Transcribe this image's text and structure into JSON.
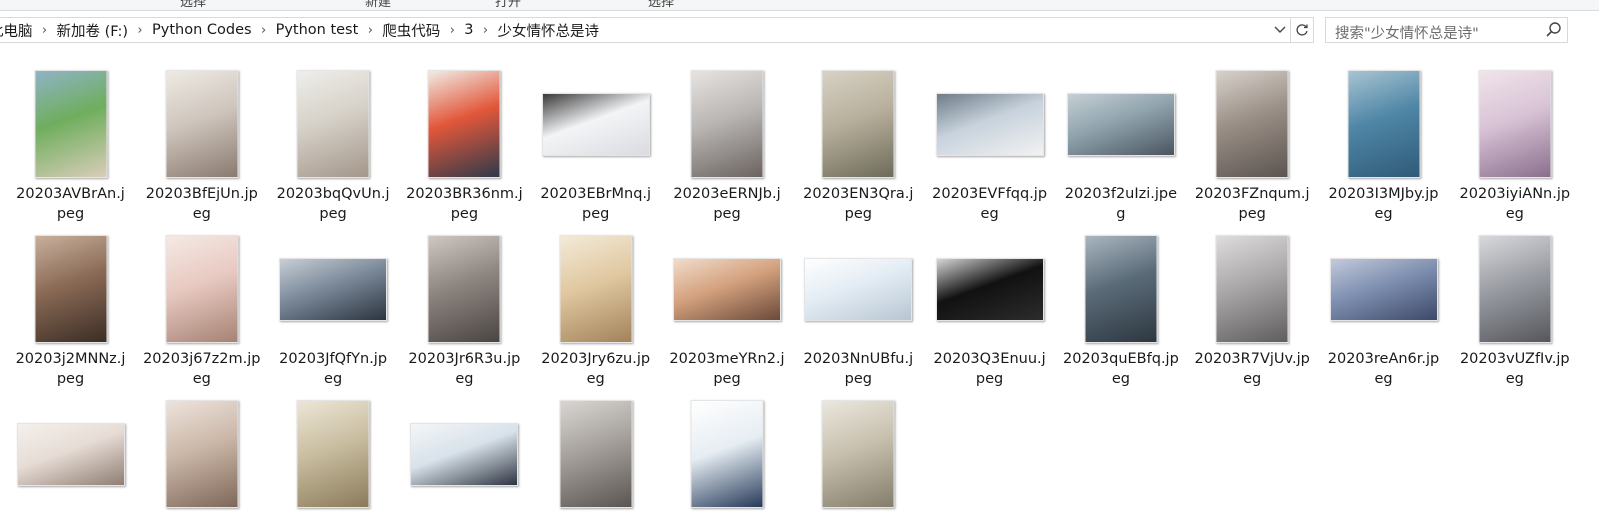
{
  "ribbon": {
    "labels": [
      "选择",
      "新建",
      "打开",
      "选择"
    ]
  },
  "address": {
    "crumbs": [
      "此电脑",
      "新加卷 (F:)",
      "Python Codes",
      "Python test",
      "爬虫代码",
      "3",
      "少女情怀总是诗"
    ]
  },
  "search": {
    "placeholder": "搜索\"少女情怀总是诗\""
  },
  "files": [
    {
      "name_lines": "20203AVBrAn.j\npeg",
      "orient": "p",
      "colors": [
        "#6fae5d",
        "#d9cdb9",
        "#8fb3c7"
      ]
    },
    {
      "name_lines": "20203BfEjUn.jp\neg",
      "orient": "p",
      "colors": [
        "#cfc6bd",
        "#8a7a70",
        "#eeeae4"
      ]
    },
    {
      "name_lines": "20203bqQvUn.j\npeg",
      "orient": "p",
      "colors": [
        "#d6d1c8",
        "#a3968a",
        "#efeeea"
      ]
    },
    {
      "name_lines": "20203BR36nm.j\npeg",
      "orient": "p",
      "colors": [
        "#e2573a",
        "#2e3a4a",
        "#f1ece6"
      ]
    },
    {
      "name_lines": "20203EBrMnq.j\npeg",
      "orient": "l",
      "colors": [
        "#f3f4f6",
        "#d9dbe0",
        "#3a3a3a"
      ]
    },
    {
      "name_lines": "20203eERNJb.j\npeg",
      "orient": "p",
      "colors": [
        "#b9b6b4",
        "#6b6360",
        "#e6e3e1"
      ]
    },
    {
      "name_lines": "20203EN3Qra.j\npeg",
      "orient": "p",
      "colors": [
        "#b8b09d",
        "#6e6b5a",
        "#d7d2c4"
      ]
    },
    {
      "name_lines": "20203EVFfqq.jp\neg",
      "orient": "l",
      "colors": [
        "#c7d2dc",
        "#f2f2f2",
        "#6f7c88"
      ]
    },
    {
      "name_lines": "20203f2uIzi.jpe\ng",
      "orient": "l",
      "colors": [
        "#8fa3ad",
        "#4a5560",
        "#c6cfd4"
      ]
    },
    {
      "name_lines": "20203FZnqum.j\npeg",
      "orient": "p",
      "colors": [
        "#9a8f86",
        "#5b5450",
        "#d7d1cb"
      ]
    },
    {
      "name_lines": "20203I3MJby.jp\neg",
      "orient": "p",
      "colors": [
        "#4f86a6",
        "#2f5a78",
        "#a7c4d2"
      ]
    },
    {
      "name_lines": "20203iyiANn.jp\neg",
      "orient": "p",
      "colors": [
        "#d8c3d6",
        "#8a6f8d",
        "#f1e4ea"
      ]
    },
    {
      "name_lines": "20203j2MNNz.j\npeg",
      "orient": "p",
      "colors": [
        "#8a6a55",
        "#3b2d25",
        "#c8b09d"
      ]
    },
    {
      "name_lines": "20203j67z2m.jp\neg",
      "orient": "p",
      "colors": [
        "#e8c9c1",
        "#a58274",
        "#f5e9e4"
      ]
    },
    {
      "name_lines": "20203JfQfYn.jp\neg",
      "orient": "l",
      "colors": [
        "#7b8a9a",
        "#2c3440",
        "#c8ced5"
      ]
    },
    {
      "name_lines": "20203Jr6R3u.jp\neg",
      "orient": "p",
      "colors": [
        "#8d8580",
        "#4b4542",
        "#cfc8c2"
      ]
    },
    {
      "name_lines": "20203Jry6zu.jp\neg",
      "orient": "p",
      "colors": [
        "#e0c8a0",
        "#a3825b",
        "#f3ead9"
      ]
    },
    {
      "name_lines": "20203meYRn2.j\npeg",
      "orient": "l",
      "colors": [
        "#d4a17e",
        "#6a4a39",
        "#f1dccb"
      ]
    },
    {
      "name_lines": "20203NnUBfu.j\npeg",
      "orient": "l",
      "colors": [
        "#e3ecf4",
        "#b8c6d2",
        "#ffffff"
      ]
    },
    {
      "name_lines": "20203Q3Enuu.j\npeg",
      "orient": "l",
      "colors": [
        "#111111",
        "#2c2c2c",
        "#d6d6d6"
      ]
    },
    {
      "name_lines": "20203quEBfq.jp\neg",
      "orient": "p",
      "colors": [
        "#5a6b78",
        "#2d3740",
        "#a9b6c0"
      ]
    },
    {
      "name_lines": "20203R7VjUv.jp\neg",
      "orient": "p",
      "colors": [
        "#a9a7a8",
        "#5f5d5e",
        "#dedcdc"
      ]
    },
    {
      "name_lines": "20203reAn6r.jp\neg",
      "orient": "l",
      "colors": [
        "#7e8fb0",
        "#3e4968",
        "#c3cadb"
      ]
    },
    {
      "name_lines": "20203vUZfIv.jp\neg",
      "orient": "p",
      "colors": [
        "#9a9ca3",
        "#55575d",
        "#d8d9dc"
      ]
    },
    {
      "name_lines": "",
      "orient": "l",
      "colors": [
        "#e6dcd5",
        "#8f7d72",
        "#f5f0ec"
      ]
    },
    {
      "name_lines": "",
      "orient": "p",
      "colors": [
        "#cbb7a8",
        "#7d6759",
        "#ede3dc"
      ]
    },
    {
      "name_lines": "",
      "orient": "p",
      "colors": [
        "#c9bda0",
        "#8a7b5a",
        "#ece6d6"
      ]
    },
    {
      "name_lines": "",
      "orient": "l",
      "colors": [
        "#d8e2ea",
        "#2e3440",
        "#f4f6f8"
      ]
    },
    {
      "name_lines": "",
      "orient": "p",
      "colors": [
        "#a5a09b",
        "#5a5550",
        "#d9d6d2"
      ]
    },
    {
      "name_lines": "",
      "orient": "p",
      "colors": [
        "#e6edf3",
        "#263a59",
        "#ffffff"
      ]
    },
    {
      "name_lines": "",
      "orient": "p",
      "colors": [
        "#c7c0ae",
        "#847d6c",
        "#ebe7dd"
      ]
    }
  ]
}
